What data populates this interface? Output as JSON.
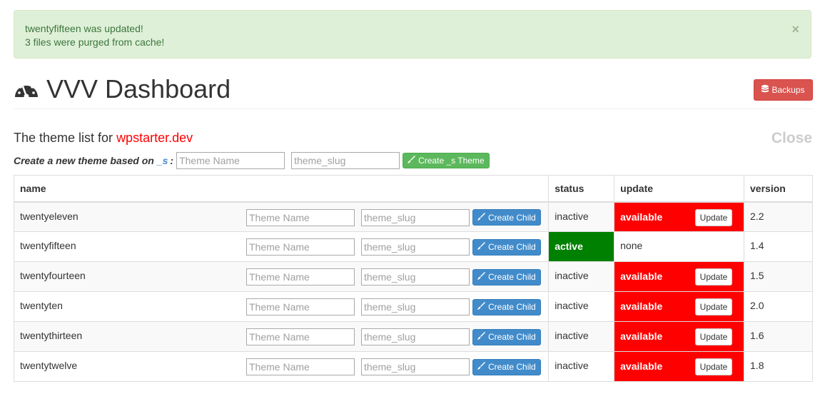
{
  "alert": {
    "line1": "twentyfifteen was updated!",
    "line2": "3 files were purged from cache!",
    "close": "×"
  },
  "header": {
    "title": "VVV Dashboard",
    "icon": "dashboard-icon",
    "backups_label": "Backups",
    "backups_icon": "database-icon"
  },
  "section": {
    "heading_prefix": "The theme list for ",
    "host": "wpstarter.dev",
    "close": "Close"
  },
  "create": {
    "label_prefix": "Create a new theme based on",
    "underscores": "_s",
    "colon": ":",
    "name_placeholder": "Theme Name",
    "slug_placeholder": "theme_slug",
    "button": "Create _s Theme",
    "button_icon": "brush-icon"
  },
  "table": {
    "headers": {
      "name": "name",
      "status": "status",
      "update": "update",
      "version": "version"
    },
    "child_name_placeholder": "Theme Name",
    "child_slug_placeholder": "theme_slug",
    "child_button": "Create Child",
    "update_button": "Update",
    "rows": [
      {
        "name": "twentyeleven",
        "status": "inactive",
        "update": "available",
        "version": "2.2"
      },
      {
        "name": "twentyfifteen",
        "status": "active",
        "update": "none",
        "version": "1.4"
      },
      {
        "name": "twentyfourteen",
        "status": "inactive",
        "update": "available",
        "version": "1.5"
      },
      {
        "name": "twentyten",
        "status": "inactive",
        "update": "available",
        "version": "2.0"
      },
      {
        "name": "twentythirteen",
        "status": "inactive",
        "update": "available",
        "version": "1.6"
      },
      {
        "name": "twentytwelve",
        "status": "inactive",
        "update": "available",
        "version": "1.8"
      }
    ]
  },
  "colors": {
    "alert_bg": "#dff0d8",
    "alert_text": "#3c763d",
    "danger": "#d9534f",
    "success": "#5cb85c",
    "primary": "#428bca",
    "active_status": "#008000",
    "update_available": "#ff0000"
  }
}
